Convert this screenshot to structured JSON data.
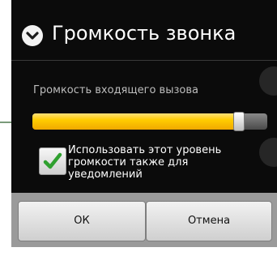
{
  "dialog": {
    "title": "Громкость звонка",
    "volume_label": "Громкость входящего вызова",
    "volume_level_fraction": 0.88,
    "checkbox": {
      "checked": true,
      "label": "Использовать этот уровень громкости также для уведомлений"
    },
    "buttons": {
      "ok_label": "ОК",
      "cancel_label": "Отмена"
    }
  },
  "icons": {
    "title": "chevron-down-circle-icon",
    "checkbox": "checkmark-icon"
  },
  "colors": {
    "slider_fill": "#ffcc00",
    "checkmark": "#2fa02f",
    "dialog_background": "#0b0b0b"
  }
}
